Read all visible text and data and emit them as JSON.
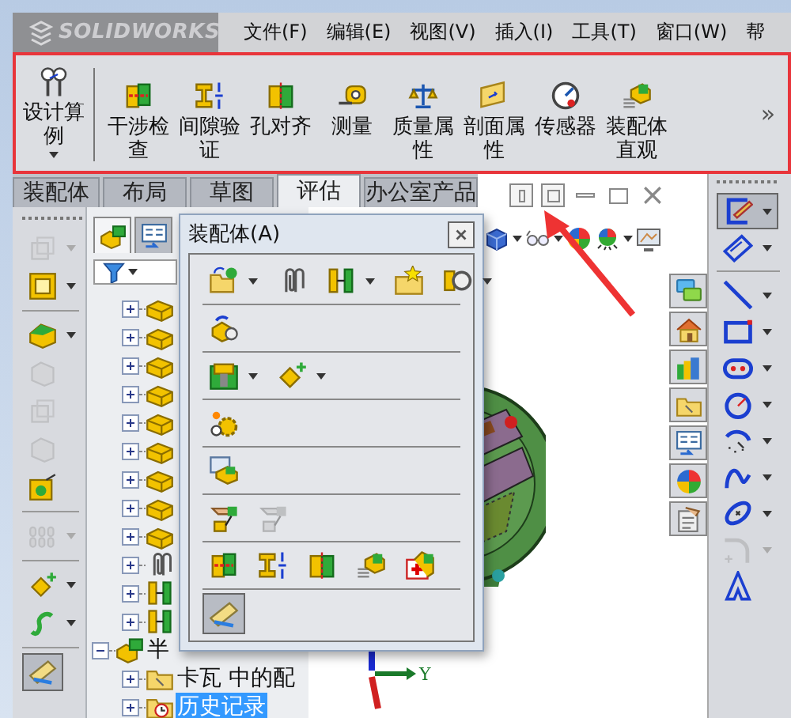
{
  "menu_bar": {
    "logo": "SOLIDWORKS",
    "items": [
      "文件(F)",
      "编辑(E)",
      "视图(V)",
      "插入(I)",
      "工具(T)",
      "窗口(W)",
      "帮"
    ]
  },
  "toolbar": {
    "buttons": [
      {
        "label": "设计算例",
        "dropdown": true
      },
      {
        "label": "干涉检查",
        "dropdown": false
      },
      {
        "label": "间隙验证",
        "dropdown": false
      },
      {
        "label": "孔对齐",
        "dropdown": false
      },
      {
        "label": "测量",
        "dropdown": false
      },
      {
        "label": "质量属性",
        "dropdown": false
      },
      {
        "label": "剖面属性",
        "dropdown": false
      },
      {
        "label": "传感器",
        "dropdown": false
      },
      {
        "label": "装配体直观",
        "dropdown": false
      }
    ],
    "overflow": "»"
  },
  "tabs": [
    {
      "label": "装配体",
      "selected": false
    },
    {
      "label": "布局",
      "selected": false
    },
    {
      "label": "草图",
      "selected": false
    },
    {
      "label": "评估",
      "selected": true
    },
    {
      "label": "办公室产品",
      "selected": false
    }
  ],
  "left_toolbar": [
    {
      "dropdown": true,
      "disabled": true,
      "pressed": false
    },
    {
      "dropdown": true,
      "disabled": false,
      "pressed": false
    },
    {
      "dropdown": true,
      "disabled": false,
      "pressed": false
    },
    {
      "dropdown": false,
      "disabled": true,
      "pressed": false
    },
    {
      "dropdown": false,
      "disabled": true,
      "pressed": false
    },
    {
      "dropdown": false,
      "disabled": true,
      "pressed": false
    },
    {
      "dropdown": false,
      "disabled": false,
      "pressed": false
    },
    {
      "dropdown": true,
      "disabled": true,
      "pressed": false
    },
    {
      "dropdown": true,
      "disabled": false,
      "pressed": false
    },
    {
      "dropdown": true,
      "disabled": false,
      "pressed": false
    },
    {
      "dropdown": false,
      "disabled": false,
      "pressed": true
    }
  ],
  "feature_tree": {
    "panel_tabs": [
      {
        "selected": true
      },
      {
        "selected": false
      }
    ],
    "items": [
      {
        "kind": "part",
        "expanded": false,
        "selected": false
      },
      {
        "kind": "part",
        "expanded": false,
        "selected": false
      },
      {
        "kind": "part",
        "expanded": false,
        "selected": false
      },
      {
        "kind": "part",
        "expanded": false,
        "selected": false
      },
      {
        "kind": "part",
        "expanded": false,
        "selected": false
      },
      {
        "kind": "part",
        "expanded": false,
        "selected": false
      },
      {
        "kind": "part",
        "expanded": false,
        "selected": false
      },
      {
        "kind": "part",
        "expanded": false,
        "selected": false
      },
      {
        "kind": "part",
        "expanded": false,
        "selected": false
      },
      {
        "kind": "clips",
        "expanded": false,
        "selected": false
      },
      {
        "kind": "mate",
        "expanded": false,
        "selected": false
      },
      {
        "kind": "mate",
        "expanded": false,
        "selected": false
      },
      {
        "kind": "assembly",
        "label": "半",
        "expanded": true,
        "selected": false,
        "children": [
          {
            "kind": "folder",
            "label": "卡瓦 中的配",
            "expanded": false,
            "selected": false
          },
          {
            "kind": "history",
            "label": "历史记录",
            "expanded": false,
            "selected": true
          }
        ]
      }
    ]
  },
  "floating_panel": {
    "title": "装配体(A)",
    "rows": [
      [
        {
          "dropdown": true,
          "disabled": false,
          "pressed": false
        },
        {
          "dropdown": false,
          "disabled": false,
          "pressed": false
        },
        {
          "dropdown": true,
          "disabled": false,
          "pressed": false
        },
        {
          "dropdown": false,
          "disabled": false,
          "pressed": false
        },
        {
          "dropdown": true,
          "disabled": false,
          "pressed": false
        }
      ],
      [
        {
          "dropdown": false,
          "disabled": false,
          "pressed": false
        }
      ],
      [
        {
          "dropdown": true,
          "disabled": false,
          "pressed": false
        },
        {
          "dropdown": true,
          "disabled": false,
          "pressed": false
        }
      ],
      [
        {
          "dropdown": false,
          "disabled": false,
          "pressed": false
        }
      ],
      [
        {
          "dropdown": false,
          "disabled": false,
          "pressed": false
        }
      ],
      [
        {
          "dropdown": false,
          "disabled": false,
          "pressed": false
        },
        {
          "dropdown": false,
          "disabled": true,
          "pressed": false
        }
      ],
      [
        {
          "dropdown": false,
          "disabled": false,
          "pressed": false
        },
        {
          "dropdown": false,
          "disabled": false,
          "pressed": false
        },
        {
          "dropdown": false,
          "disabled": false,
          "pressed": false
        },
        {
          "dropdown": false,
          "disabled": false,
          "pressed": false
        },
        {
          "dropdown": false,
          "disabled": false,
          "pressed": false
        }
      ],
      [
        {
          "dropdown": false,
          "disabled": false,
          "pressed": true
        }
      ]
    ]
  },
  "graphics": {
    "axis_label": "Y"
  },
  "right_toolbar": [
    {
      "dropdown": true,
      "disabled": false,
      "pressed": true
    },
    {
      "dropdown": true,
      "disabled": false,
      "pressed": false
    },
    {
      "dropdown": true,
      "disabled": false,
      "pressed": false
    },
    {
      "dropdown": true,
      "disabled": false,
      "pressed": false
    },
    {
      "dropdown": true,
      "disabled": false,
      "pressed": false
    },
    {
      "dropdown": true,
      "disabled": false,
      "pressed": false
    },
    {
      "dropdown": true,
      "disabled": false,
      "pressed": false
    },
    {
      "dropdown": true,
      "disabled": false,
      "pressed": false
    },
    {
      "dropdown": true,
      "disabled": false,
      "pressed": false
    },
    {
      "dropdown": true,
      "disabled": true,
      "pressed": false
    },
    {
      "dropdown": false,
      "disabled": false,
      "pressed": false
    }
  ]
}
